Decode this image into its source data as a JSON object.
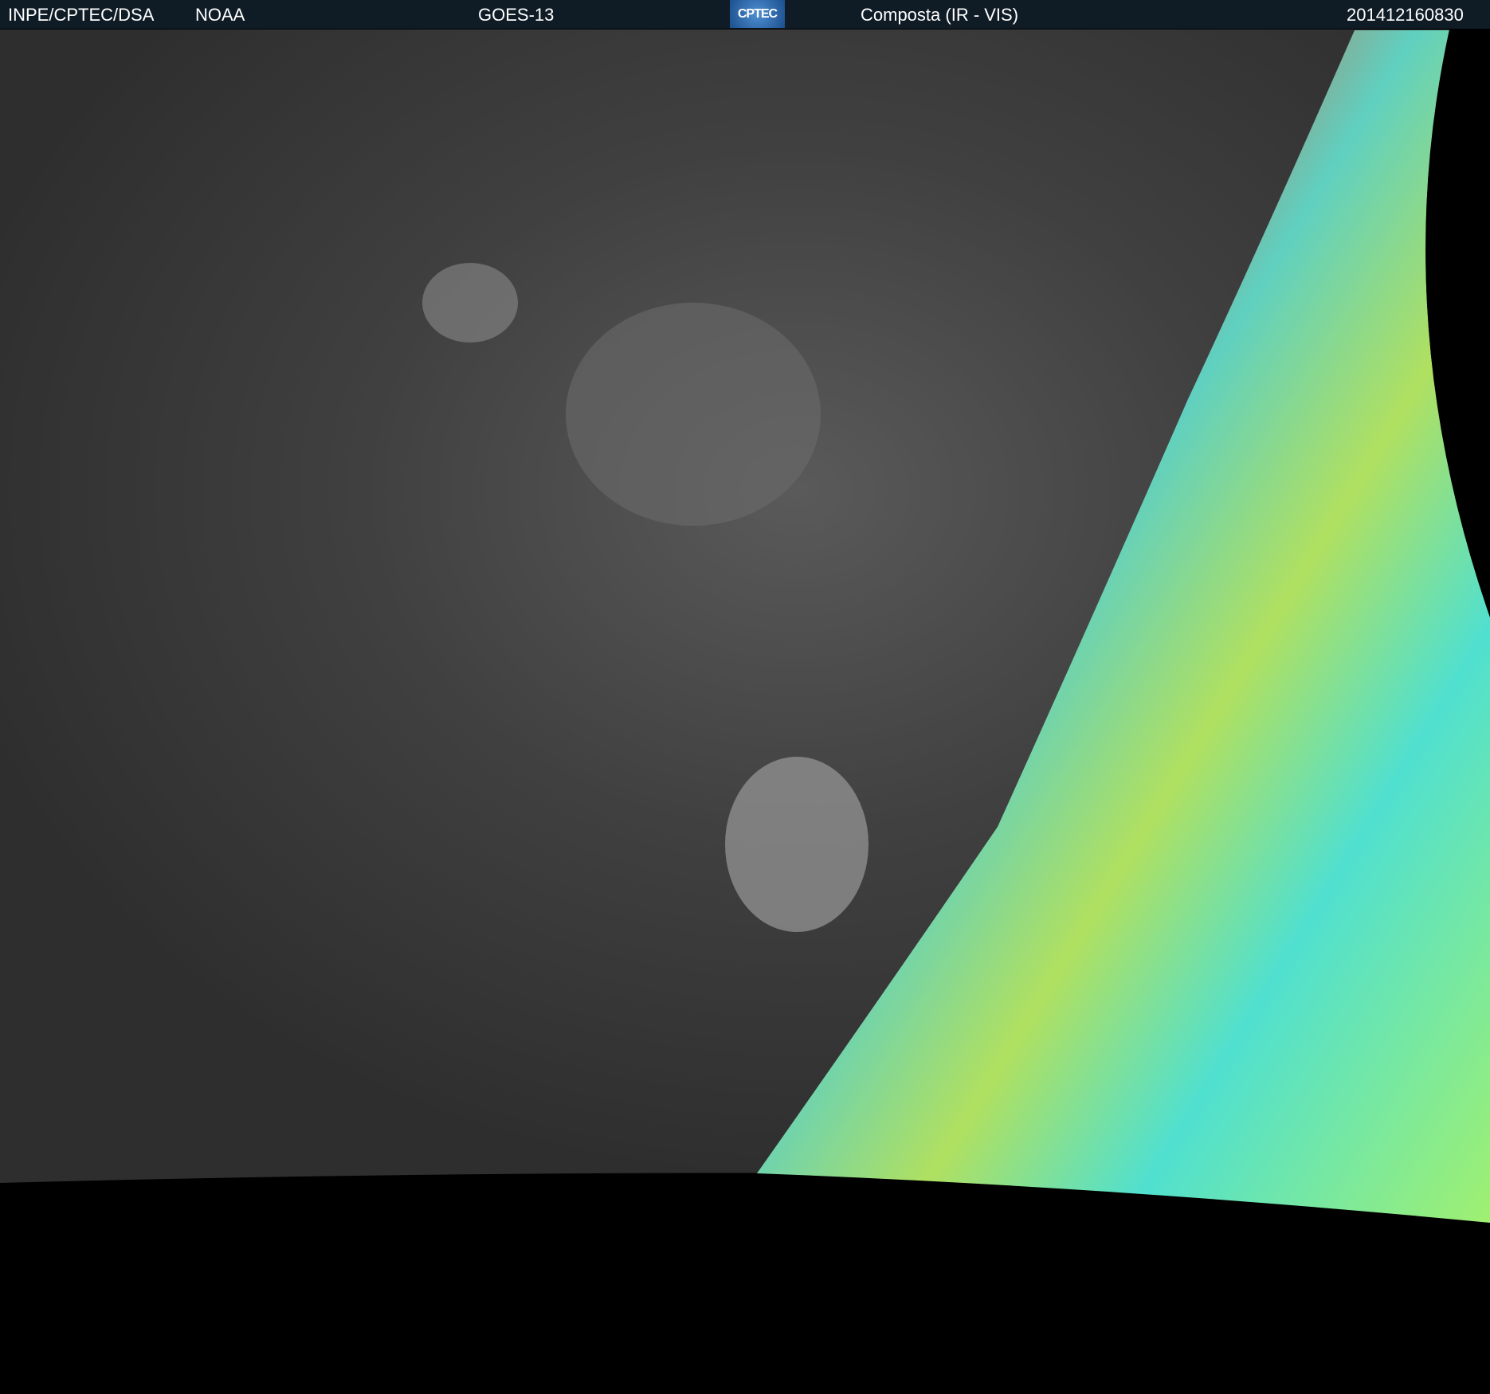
{
  "header": {
    "institution": "INPE/CPTEC/DSA",
    "agency": "NOAA",
    "satellite": "GOES-13",
    "logo_text": "CPTEC",
    "product": "Composta (IR - VIS)",
    "timestamp": "201412160830"
  },
  "colors": {
    "header_bg": "#0f1c26",
    "ir_gray": "#3a3a3a",
    "vis_red": "#c0604a",
    "vis_green": "#a8e060",
    "vis_cyan": "#40e0e0"
  }
}
